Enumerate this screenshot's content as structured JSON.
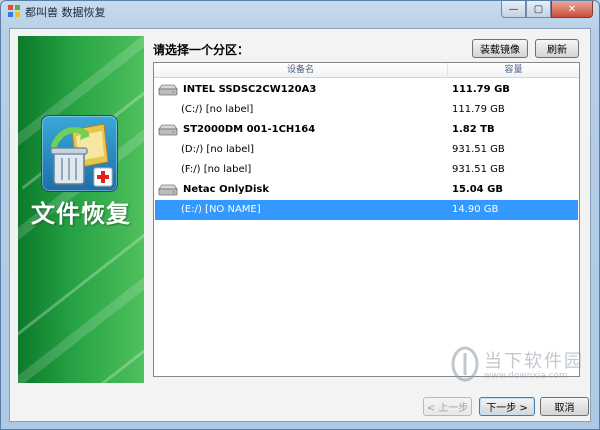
{
  "window": {
    "title": "都叫兽 数据恢复",
    "controls": {
      "minimize": "—",
      "maximize": "▢",
      "close": "✕"
    }
  },
  "banner": {
    "label": "文件恢复",
    "icon": "recycle-bin-icon"
  },
  "main": {
    "heading": "请选择一个分区：",
    "buttons": {
      "mount_image": "装载镜像",
      "refresh": "刷新"
    }
  },
  "list": {
    "columns": {
      "device": "设备名",
      "capacity": "容量"
    },
    "rows": [
      {
        "kind": "disk",
        "name": "INTEL SSDSC2CW120A3",
        "capacity": "111.79 GB"
      },
      {
        "kind": "partition",
        "name": "(C:/) [no label]",
        "capacity": "111.79 GB"
      },
      {
        "kind": "disk",
        "name": "ST2000DM 001-1CH164",
        "capacity": "1.82 TB"
      },
      {
        "kind": "partition",
        "name": "(D:/) [no label]",
        "capacity": "931.51 GB"
      },
      {
        "kind": "partition",
        "name": "(F:/) [no label]",
        "capacity": "931.51 GB"
      },
      {
        "kind": "disk",
        "name": "Netac OnlyDisk",
        "capacity": "15.04 GB"
      },
      {
        "kind": "partition",
        "name": "(E:/) [NO NAME]",
        "capacity": "14.90 GB",
        "selected": true
      }
    ]
  },
  "footer": {
    "back": "< 上一步",
    "next": "下一步 >",
    "cancel": "取消"
  },
  "watermark": {
    "text": "当下软件园",
    "url": "www.downxia.com"
  },
  "colors": {
    "selection": "#3399ff",
    "banner_green": "#1e9a3c",
    "header_text": "#4d6185"
  }
}
